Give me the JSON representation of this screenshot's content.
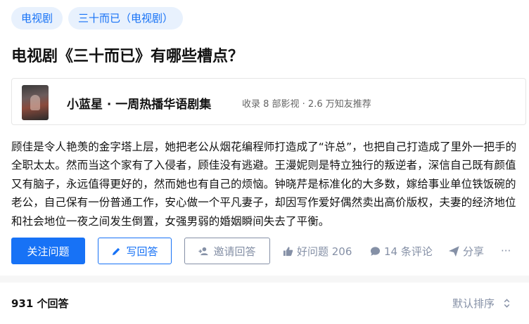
{
  "tags": [
    "电视剧",
    "三十而已（电视剧）"
  ],
  "question_title": "电视剧《三十而已》有哪些槽点？",
  "card": {
    "name": "小蓝星 · 一周热播华语剧集",
    "meta": "收录 8 部影视 · 2.6 万知友推荐"
  },
  "description": "顾佳是令人艳羡的金字塔上层，她把老公从烟花编程师打造成了“许总”，也把自己打造成了里外一把手的全职太太。然而当这个家有了入侵者，顾佳没有逃避。王漫妮则是特立独行的叛逆者，深信自己既有颜值又有脑子，永远值得更好的，然而她也有自己的烦恼。钟晓芹是标准化的大多数，嫁给事业单位铁饭碗的老公，自己保有一份普通工作，安心做一个平凡妻子，却因写作爱好偶然卖出高价版权，夫妻的经济地位和社会地位一夜之间发生倒置，女强男弱的婚姻瞬间失去了平衡。",
  "actions": {
    "follow": "关注问题",
    "write": "写回答",
    "invite": "邀请回答",
    "good_question": "好问题 206",
    "comments": "14 条评论",
    "share": "分享",
    "more": "···"
  },
  "answers_count": "931 个回答",
  "sort_label": "默认排序",
  "colors": {
    "brand": "#1772f6",
    "tag_bg": "#e8f1fd",
    "muted": "#8590a6"
  },
  "icons": [
    "pencil-icon",
    "add-person-icon",
    "thumbs-up-icon",
    "comment-bubble-icon",
    "paper-plane-icon",
    "more-icon",
    "sort-chevrons-icon"
  ]
}
